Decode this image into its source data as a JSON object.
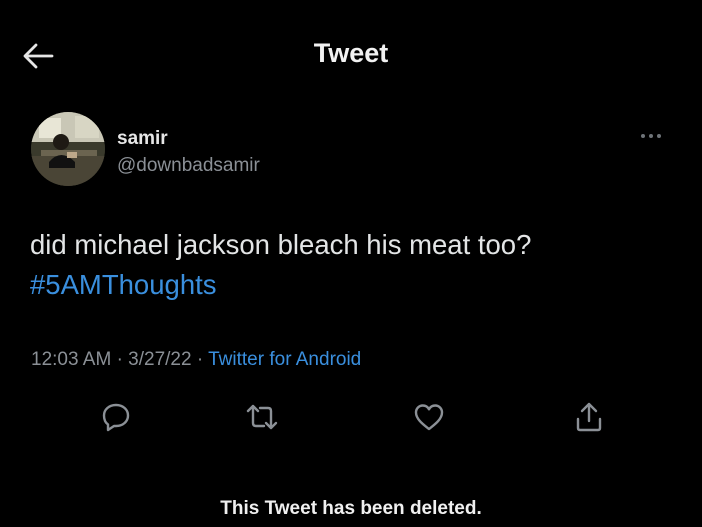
{
  "header": {
    "title": "Tweet",
    "back_icon": "arrow-left-icon"
  },
  "author": {
    "display_name": "samir",
    "handle": "@downbadsamir",
    "more_icon": "more-horizontal-icon"
  },
  "tweet": {
    "text": "did michael jackson bleach his meat too?",
    "hashtag": "#5AMThoughts"
  },
  "meta": {
    "time": "12:03 AM",
    "separator": "·",
    "date": "3/27/22",
    "source": "Twitter for Android"
  },
  "actions": [
    {
      "name": "reply",
      "icon": "reply-icon"
    },
    {
      "name": "retweet",
      "icon": "retweet-icon"
    },
    {
      "name": "like",
      "icon": "heart-icon"
    },
    {
      "name": "share",
      "icon": "share-icon"
    }
  ],
  "footer": {
    "notice": "This Tweet has been deleted."
  },
  "colors": {
    "background": "#000000",
    "text": "#e3e5e6",
    "secondary": "#8b9096",
    "link": "#3a8fde"
  }
}
